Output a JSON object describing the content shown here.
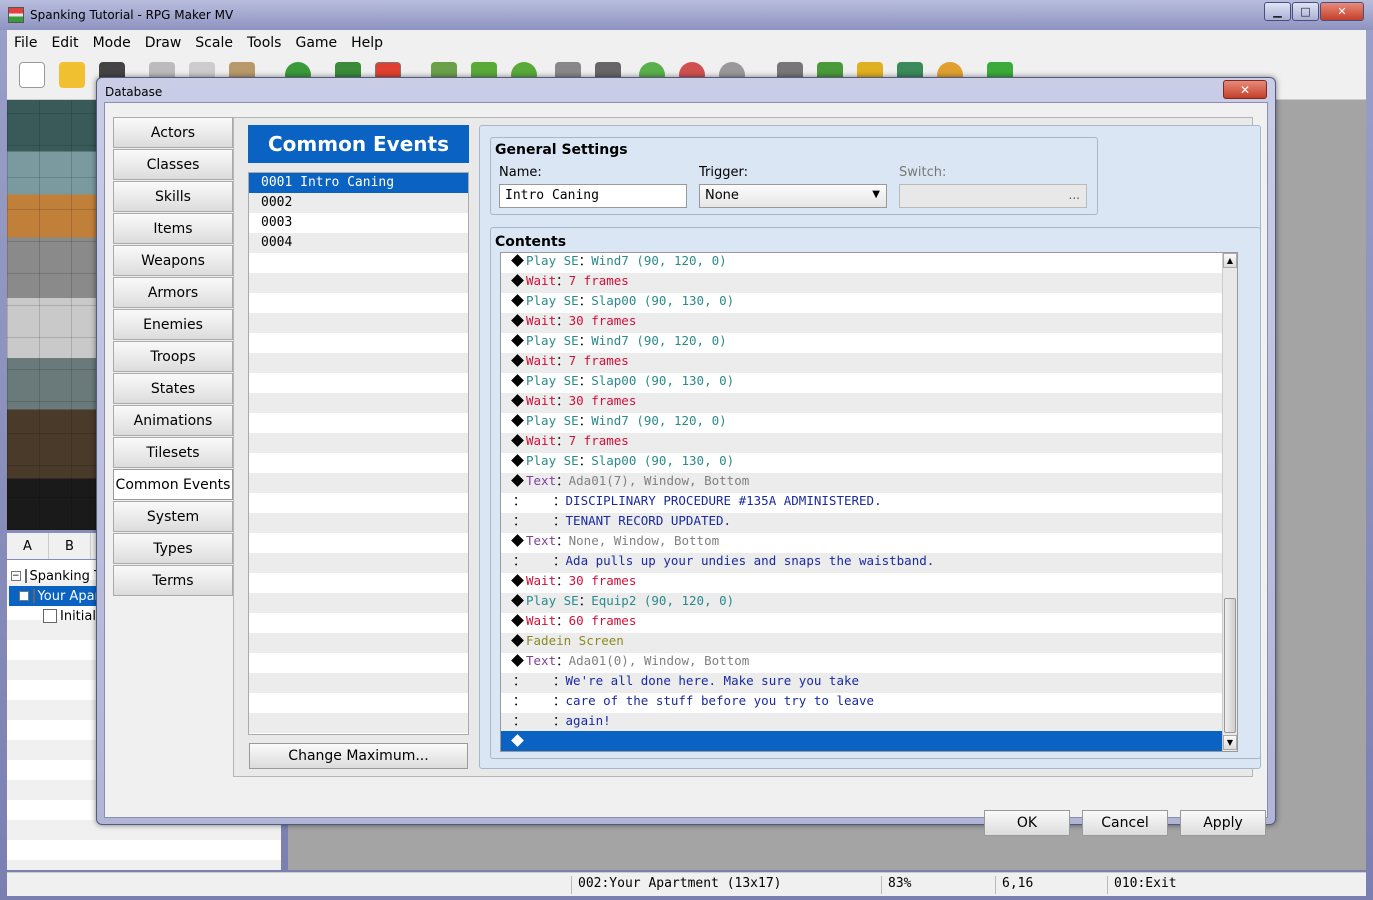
{
  "app": {
    "title": "Spanking Tutorial - RPG Maker MV",
    "minimize_label": "▁",
    "maximize_label": "□",
    "close_label": "✕"
  },
  "menu": [
    "File",
    "Edit",
    "Mode",
    "Draw",
    "Scale",
    "Tools",
    "Game",
    "Help"
  ],
  "tile_tabs": [
    "A",
    "B"
  ],
  "map_tree": {
    "root": "Spanking Tutorial",
    "child": "Your Apartment",
    "grandchild": "Initial"
  },
  "status": {
    "map": "002:Your Apartment (13x17)",
    "zoom": "83%",
    "coords": "6,16",
    "event": "010:Exit"
  },
  "database": {
    "title": "Database",
    "close_label": "✕",
    "categories": [
      "Actors",
      "Classes",
      "Skills",
      "Items",
      "Weapons",
      "Armors",
      "Enemies",
      "Troops",
      "States",
      "Animations",
      "Tilesets",
      "Common Events",
      "System",
      "Types",
      "Terms"
    ],
    "active_category": "Common Events",
    "list_header": "Common Events",
    "list_items": [
      "0001 Intro Caning",
      "0002",
      "0003",
      "0004"
    ],
    "change_max_label": "Change Maximum...",
    "general_settings": {
      "title": "General Settings",
      "name_label": "Name:",
      "name_value": "Intro Caning",
      "trigger_label": "Trigger:",
      "trigger_value": "None",
      "switch_label": "Switch:",
      "switch_button": "..."
    },
    "contents_title": "Contents",
    "ok_label": "OK",
    "cancel_label": "Cancel",
    "apply_label": "Apply"
  },
  "events": [
    {
      "marker": "diamond",
      "cmd": "Play SE",
      "sep": "：",
      "args": "Wind7 (90, 120, 0)",
      "cmd_class": "c-se",
      "args_class": "c-se"
    },
    {
      "marker": "diamond",
      "cmd": "Wait",
      "sep": "：",
      "args": "7 frames",
      "cmd_class": "c-wait",
      "args_class": "c-wait"
    },
    {
      "marker": "diamond",
      "cmd": "Play SE",
      "sep": "：",
      "args": "Slap00 (90, 130, 0)",
      "cmd_class": "c-se",
      "args_class": "c-se"
    },
    {
      "marker": "diamond",
      "cmd": "Wait",
      "sep": "：",
      "args": "30 frames",
      "cmd_class": "c-wait",
      "args_class": "c-wait"
    },
    {
      "marker": "diamond",
      "cmd": "Play SE",
      "sep": "：",
      "args": "Wind7 (90, 120, 0)",
      "cmd_class": "c-se",
      "args_class": "c-se"
    },
    {
      "marker": "diamond",
      "cmd": "Wait",
      "sep": "：",
      "args": "7 frames",
      "cmd_class": "c-wait",
      "args_class": "c-wait"
    },
    {
      "marker": "diamond",
      "cmd": "Play SE",
      "sep": "：",
      "args": "Slap00 (90, 130, 0)",
      "cmd_class": "c-se",
      "args_class": "c-se"
    },
    {
      "marker": "diamond",
      "cmd": "Wait",
      "sep": "：",
      "args": "30 frames",
      "cmd_class": "c-wait",
      "args_class": "c-wait"
    },
    {
      "marker": "diamond",
      "cmd": "Play SE",
      "sep": "：",
      "args": "Wind7 (90, 120, 0)",
      "cmd_class": "c-se",
      "args_class": "c-se"
    },
    {
      "marker": "diamond",
      "cmd": "Wait",
      "sep": "：",
      "args": "7 frames",
      "cmd_class": "c-wait",
      "args_class": "c-wait"
    },
    {
      "marker": "diamond",
      "cmd": "Play SE",
      "sep": "：",
      "args": "Slap00 (90, 130, 0)",
      "cmd_class": "c-se",
      "args_class": "c-se"
    },
    {
      "marker": "diamond",
      "cmd": "Text",
      "sep": "：",
      "args": "Ada01(7), Window, Bottom",
      "cmd_class": "c-text",
      "args_class": "c-gray"
    },
    {
      "marker": "colon",
      "cmd": "：",
      "sep": "：",
      "args": "DISCIPLINARY PROCEDURE #135A ADMINISTERED.",
      "cmd_class": "",
      "args_class": "c-blue"
    },
    {
      "marker": "colon",
      "cmd": "：",
      "sep": "：",
      "args": "TENANT RECORD UPDATED.",
      "cmd_class": "",
      "args_class": "c-blue"
    },
    {
      "marker": "diamond",
      "cmd": "Text",
      "sep": "：",
      "args": "None, Window, Bottom",
      "cmd_class": "c-text",
      "args_class": "c-gray"
    },
    {
      "marker": "colon",
      "cmd": "：",
      "sep": "：",
      "args": "Ada pulls up your undies and snaps the waistband.",
      "cmd_class": "",
      "args_class": "c-blue"
    },
    {
      "marker": "diamond",
      "cmd": "Wait",
      "sep": "：",
      "args": "30 frames",
      "cmd_class": "c-wait",
      "args_class": "c-wait"
    },
    {
      "marker": "diamond",
      "cmd": "Play SE",
      "sep": "：",
      "args": "Equip2 (90, 120, 0)",
      "cmd_class": "c-se",
      "args_class": "c-se"
    },
    {
      "marker": "diamond",
      "cmd": "Wait",
      "sep": "：",
      "args": "60 frames",
      "cmd_class": "c-wait",
      "args_class": "c-wait"
    },
    {
      "marker": "diamond",
      "cmd": "Fadein Screen",
      "sep": "",
      "args": "",
      "cmd_class": "c-fade",
      "args_class": ""
    },
    {
      "marker": "diamond",
      "cmd": "Text",
      "sep": "：",
      "args": "Ada01(0), Window, Bottom",
      "cmd_class": "c-text",
      "args_class": "c-gray"
    },
    {
      "marker": "colon",
      "cmd": "：",
      "sep": "：",
      "args": "We're all done here. Make sure you take",
      "cmd_class": "",
      "args_class": "c-blue"
    },
    {
      "marker": "colon",
      "cmd": "：",
      "sep": "：",
      "args": "care of the stuff before you try to leave",
      "cmd_class": "",
      "args_class": "c-blue"
    },
    {
      "marker": "colon",
      "cmd": "：",
      "sep": "：",
      "args": "again!",
      "cmd_class": "",
      "args_class": "c-blue"
    },
    {
      "marker": "diamond",
      "cmd": "",
      "sep": "",
      "args": "",
      "cmd_class": "",
      "args_class": "",
      "selected": true
    }
  ],
  "scroll": {
    "up": "▲",
    "down": "▼"
  },
  "toolbar_icons": [
    "new-project-icon",
    "open-project-icon",
    "save-project-icon",
    "cut-icon",
    "copy-icon",
    "paste-icon",
    "undo-icon",
    "map-mode-icon",
    "event-mode-icon",
    "pencil-icon",
    "rectangle-icon",
    "ellipse-icon",
    "fill-icon",
    "shadow-pen-icon",
    "zoom-in-icon",
    "zoom-out-icon",
    "actual-size-icon",
    "database-icon",
    "plugin-manager-icon",
    "sound-test-icon",
    "event-searcher-icon",
    "character-generator-icon",
    "playtest-icon"
  ],
  "colors": {
    "accent": "#0a62c2",
    "se": "#2a8a8a",
    "wait": "#d0103a",
    "text": "#8040a0",
    "message": "#1a2aa0",
    "fade": "#8a8a20"
  }
}
